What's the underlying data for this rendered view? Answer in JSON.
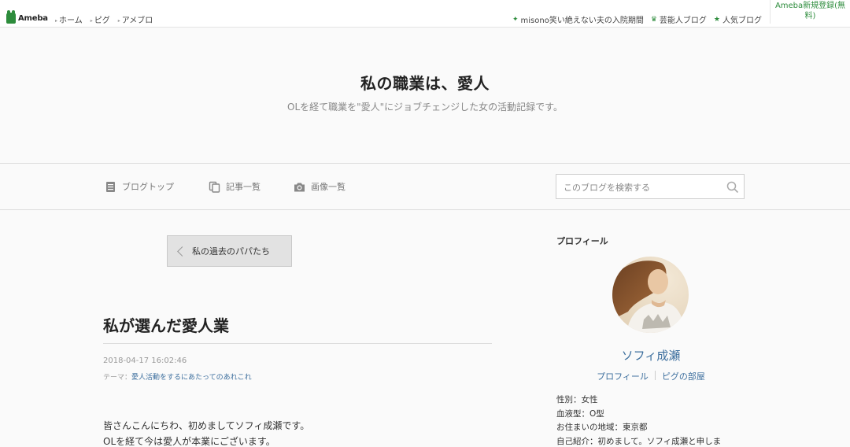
{
  "topbar": {
    "logo_text": "Ameba",
    "nav": [
      "ホーム",
      "ピグ",
      "アメブロ"
    ],
    "right_links": [
      {
        "label": "misono笑い絶えない夫の入院期間",
        "icon": "sparkle-icon"
      },
      {
        "label": "芸能人ブログ",
        "icon": "crown-icon"
      },
      {
        "label": "人気ブログ",
        "icon": "star-icon"
      }
    ],
    "register_line1": "Ameba新規登録(無",
    "register_line2": "料)"
  },
  "header": {
    "title": "私の職業は、愛人",
    "description": "OLを経て職業を\"愛人\"にジョブチェンジした女の活動記録です。"
  },
  "blognav": {
    "items": [
      {
        "label": "ブログトップ",
        "icon": "document-icon"
      },
      {
        "label": "記事一覧",
        "icon": "copy-icon"
      },
      {
        "label": "画像一覧",
        "icon": "camera-icon"
      }
    ],
    "search_placeholder": "このブログを検索する"
  },
  "article": {
    "prev_label": "私の過去のパパたち",
    "title": "私が選んだ愛人業",
    "date": "2018-04-17 16:02:46",
    "theme_prefix": "テーマ：",
    "theme": "愛人活動をするにあたってのあれこれ",
    "body": [
      "皆さんこんにちわ、初めましてソフィ成瀬です。",
      "OLを経て今は愛人が本業にございます。"
    ]
  },
  "sidebar": {
    "heading": "プロフィール",
    "name": "ソフィ成瀬",
    "links": [
      "プロフィール",
      "ピグの部屋"
    ],
    "info": [
      "性別：女性",
      "血液型：O型",
      "お住まいの地域：東京都",
      "自己紹介：初めまして。ソフィ成瀬と申しま"
    ]
  },
  "colors": {
    "brand_green": "#2d8c3c",
    "link_blue": "#3d6f9e"
  }
}
